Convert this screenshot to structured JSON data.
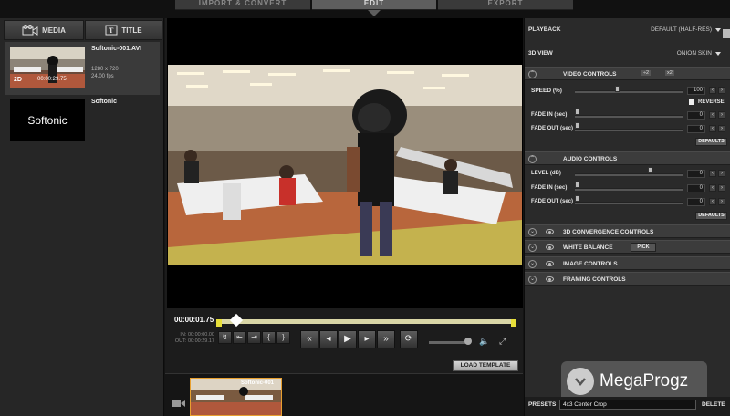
{
  "top_tabs": [
    {
      "label": "IMPORT & CONVERT",
      "active": false
    },
    {
      "label": "EDIT",
      "active": true
    },
    {
      "label": "EXPORT",
      "active": false
    }
  ],
  "left_panel": {
    "tabs": [
      {
        "label": "MEDIA",
        "icon": "camera-icon"
      },
      {
        "label": "TITLE",
        "icon": "text-tool-icon"
      }
    ],
    "items": [
      {
        "name": "Softonic-001.AVI",
        "resolution": "1280 x 720",
        "fps": "24,00 fps",
        "mode": "2D",
        "duration": "00:00:29.75"
      },
      {
        "name": "Softonic",
        "thumb_text": "Softonic"
      }
    ]
  },
  "viewer": {
    "current_timecode": "00:00:01.75",
    "in_label": "IN:",
    "in_value": "00:00:00.00",
    "out_label": "OUT:",
    "out_value": "00:00:29.17",
    "playhead_fraction": 0.06,
    "load_template_label": "LOAD TEMPLATE"
  },
  "timeline": {
    "clip_label": "Softonic-001"
  },
  "right_panel": {
    "playback_label": "PLAYBACK",
    "playback_value": "DEFAULT (HALF-RES)",
    "view3d_label": "3D VIEW",
    "view3d_value": "ONION SKIN",
    "video_controls": {
      "title": "VIDEO CONTROLS",
      "speed_minus": "÷2",
      "speed_plus": "x2",
      "speed_label": "SPEED (%)",
      "speed_value": "100",
      "reverse_label": "REVERSE",
      "fade_in_label": "FADE IN (sec)",
      "fade_in_value": "0",
      "fade_out_label": "FADE OUT (sec)",
      "fade_out_value": "0",
      "defaults_label": "DEFAULTS"
    },
    "audio_controls": {
      "title": "AUDIO CONTROLS",
      "level_label": "LEVEL (dB)",
      "level_value": "0",
      "fade_in_label": "FADE IN (sec)",
      "fade_in_value": "0",
      "fade_out_label": "FADE OUT (sec)",
      "fade_out_value": "0",
      "defaults_label": "DEFAULTS"
    },
    "collapsed_sections": [
      {
        "title": "3D CONVERGENCE CONTROLS"
      },
      {
        "title": "WHITE BALANCE",
        "extra": "PICK"
      },
      {
        "title": "IMAGE CONTROLS"
      },
      {
        "title": "FRAMING CONTROLS"
      }
    ],
    "presets_label": "PRESETS",
    "presets_value": "4x3 Center Crop",
    "delete_label": "DELETE"
  },
  "watermark": {
    "text": "MegaProgz"
  }
}
